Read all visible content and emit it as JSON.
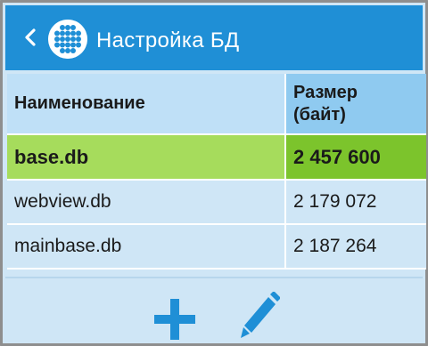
{
  "header": {
    "title": "Настройка БД",
    "back_icon": "chevron-left-icon",
    "logo_icon": "dot-grid-logo-icon",
    "color": "#1f8fd6"
  },
  "table": {
    "columns": [
      "Наименование",
      "Размер\n(байт)"
    ],
    "rows": [
      {
        "name": "base.db",
        "size": "2 457 600",
        "selected": true
      },
      {
        "name": "webview.db",
        "size": "2 179 072",
        "selected": false
      },
      {
        "name": "mainbase.db",
        "size": "2 187 264",
        "selected": false
      }
    ],
    "selected_color": "#a6dc5c"
  },
  "toolbar": {
    "add_icon": "plus-icon",
    "edit_icon": "pencil-icon",
    "icon_color": "#1f8fd6"
  }
}
